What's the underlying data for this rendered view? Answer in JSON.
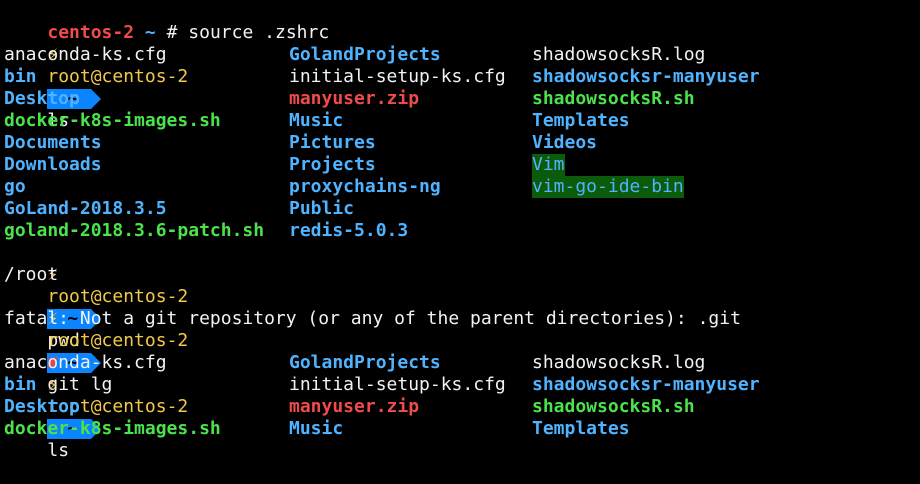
{
  "line1": {
    "host_label": "centos-2",
    "tilde": "~",
    "hash": "#",
    "command": "source .zshrc"
  },
  "prompt": {
    "bolt": "⚡",
    "user_host": "root@centos-2",
    "dir": "~",
    "cross": "✘"
  },
  "commands": {
    "ls": "ls",
    "pwd": "pwd",
    "gitlg": "git lg"
  },
  "outputs": {
    "pwd": "/root",
    "git_error": "fatal: Not a git repository (or any of the parent directories): .git"
  },
  "ls1": {
    "col1": [
      {
        "name": "anaconda-ks.cfg",
        "type": "file"
      },
      {
        "name": "bin",
        "type": "dir"
      },
      {
        "name": "Desktop",
        "type": "dir"
      },
      {
        "name": "docker-k8s-images.sh",
        "type": "exec"
      },
      {
        "name": "Documents",
        "type": "dir"
      },
      {
        "name": "Downloads",
        "type": "dir"
      },
      {
        "name": "go",
        "type": "dir"
      },
      {
        "name": "GoLand-2018.3.5",
        "type": "dir"
      },
      {
        "name": "goland-2018.3.6-patch.sh",
        "type": "exec"
      }
    ],
    "col2": [
      {
        "name": "GolandProjects",
        "type": "dir"
      },
      {
        "name": "initial-setup-ks.cfg",
        "type": "file"
      },
      {
        "name": "manyuser.zip",
        "type": "zip"
      },
      {
        "name": "Music",
        "type": "dir"
      },
      {
        "name": "Pictures",
        "type": "dir"
      },
      {
        "name": "Projects",
        "type": "dir"
      },
      {
        "name": "proxychains-ng",
        "type": "dir"
      },
      {
        "name": "Public",
        "type": "dir"
      },
      {
        "name": "redis-5.0.3",
        "type": "dir"
      }
    ],
    "col3": [
      {
        "name": "shadowsocksR.log",
        "type": "file"
      },
      {
        "name": "shadowsocksr-manyuser",
        "type": "dir"
      },
      {
        "name": "shadowsocksR.sh",
        "type": "exec"
      },
      {
        "name": "Templates",
        "type": "dir"
      },
      {
        "name": "Videos",
        "type": "dir"
      },
      {
        "name": "Vim",
        "type": "hl"
      },
      {
        "name": "vim-go-ide-bin",
        "type": "hl"
      }
    ]
  },
  "ls2": {
    "col1": [
      "anaconda-ks.cfg",
      "bin",
      "Desktop",
      "docker-k8s-images.sh"
    ],
    "col2": [
      "GolandProjects",
      "initial-setup-ks.cfg",
      "manyuser.zip",
      "Music"
    ],
    "col3": [
      "shadowsocksR.log",
      "shadowsocksr-manyuser",
      "shadowsocksR.sh",
      "Templates"
    ]
  },
  "colors": {
    "dir": "#4fb3ff",
    "exec": "#4be24b",
    "zip": "#ef4b4b",
    "segment": "#0a84ff",
    "highlight_bg": "#0b5b0b"
  }
}
